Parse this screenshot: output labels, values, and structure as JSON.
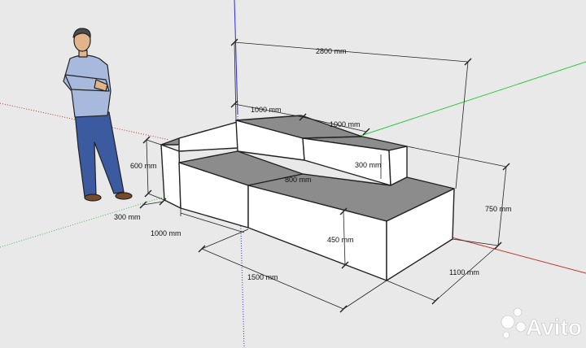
{
  "colors": {
    "background": "#e9e9e9",
    "top_face": "#8c8c8c",
    "side_face": "#ffffff",
    "axis_red": "#c0392b",
    "axis_green": "#2ecc40",
    "axis_blue": "#2b2bd6"
  },
  "dimensions": {
    "total_length": "2800 mm",
    "back_left_width": "1000 mm",
    "back_right_width": "1000 mm",
    "seat_depth": "800 mm",
    "back_height": "300 mm",
    "arm_height": "600 mm",
    "overall_height": "750 mm",
    "arm_width": "300 mm",
    "front_left_width": "1000 mm",
    "seat_height": "450 mm",
    "front_right_width": "1500 mm",
    "depth": "1100 mm"
  },
  "watermark": {
    "icon": "avito-dots-icon",
    "text": "Avito"
  },
  "figure": {
    "icon": "standing-man-figure"
  }
}
